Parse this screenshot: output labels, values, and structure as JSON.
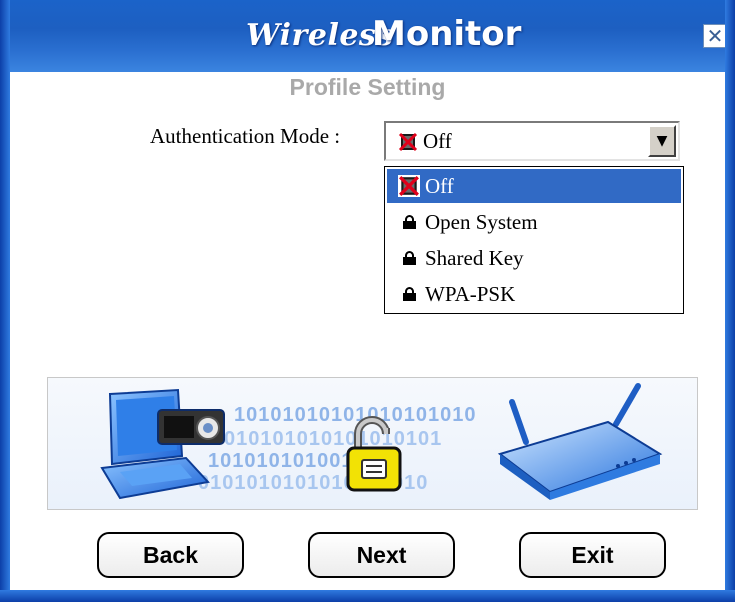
{
  "window": {
    "title_part1": "Wireless",
    "title_part2": "Monitor",
    "close_glyph": "✕"
  },
  "page": {
    "subtitle": "Profile Setting"
  },
  "form": {
    "auth_label": "Authentication Mode :",
    "auth_selected": "Off",
    "auth_options": [
      {
        "label": "Off",
        "icon": "disabled-x-icon",
        "selected": true
      },
      {
        "label": "Open System",
        "icon": "lock-icon",
        "selected": false
      },
      {
        "label": "Shared Key",
        "icon": "lock-icon",
        "selected": false
      },
      {
        "label": "WPA-PSK",
        "icon": "lock-icon",
        "selected": false
      }
    ]
  },
  "banner": {
    "binary_rows": [
      "10101010101010101010",
      "010101010101010101",
      "1010101010010100",
      "0101010101010101010"
    ]
  },
  "buttons": {
    "back": "Back",
    "next": "Next",
    "exit": "Exit"
  },
  "colors": {
    "titlebar": "#1d5fc1",
    "selection": "#316ac5",
    "subtitle": "#a9a9a9"
  }
}
